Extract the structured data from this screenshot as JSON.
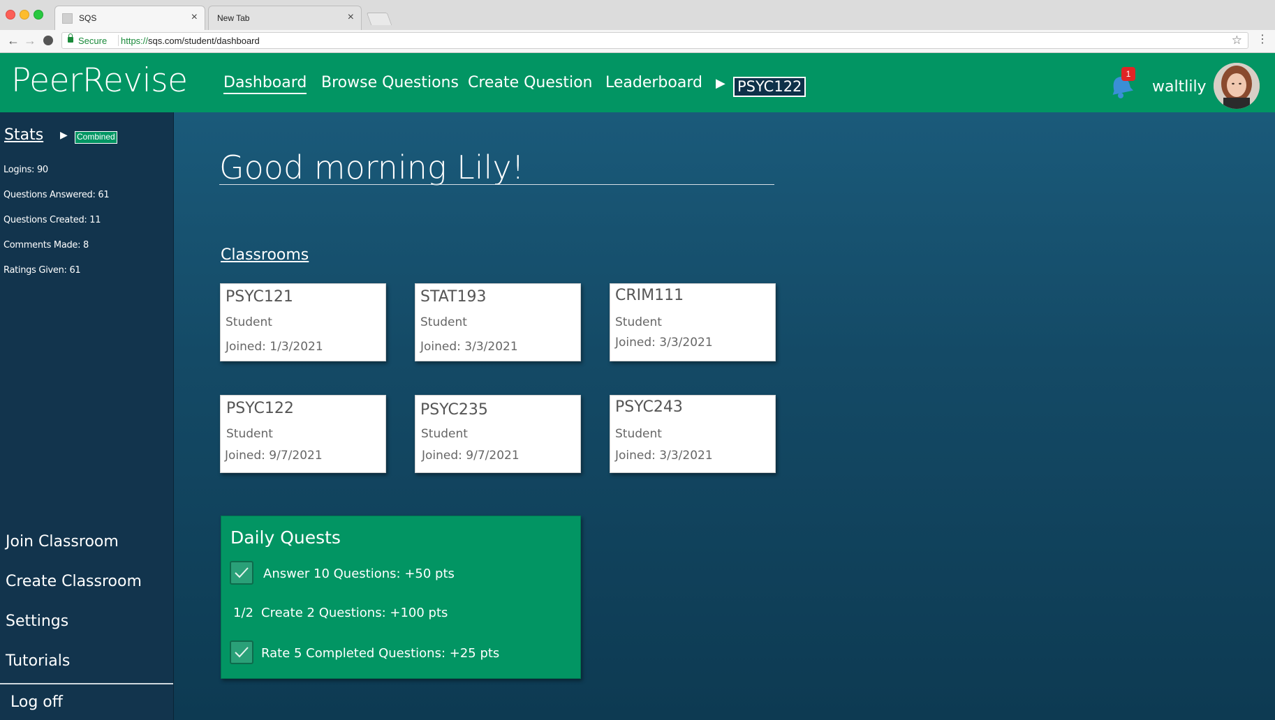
{
  "browser": {
    "tabs": [
      {
        "title": "SQS",
        "active": true
      },
      {
        "title": "New Tab",
        "active": false
      }
    ],
    "security_label": "Secure",
    "url_scheme": "https://",
    "url_rest": "sqs.com/student/dashboard"
  },
  "header": {
    "logo": "PeerRevise",
    "nav": [
      {
        "label": "Dashboard",
        "active": true
      },
      {
        "label": "Browse Questions"
      },
      {
        "label": "Create Question"
      },
      {
        "label": "Leaderboard"
      }
    ],
    "current_course": "PSYC122",
    "notification_count": "1",
    "username": "waltlily",
    "brand_color": "#029563"
  },
  "sidebar": {
    "stats_title": "Stats",
    "stats_filter": "Combined",
    "stats": [
      "Logins: 90",
      "Questions Answered: 61",
      "Questions Created: 11",
      "Comments Made: 8",
      "Ratings Given: 61"
    ],
    "links": [
      "Join Classroom",
      "Create Classroom",
      "Settings",
      "Tutorials",
      "Log off"
    ]
  },
  "main": {
    "greeting": "Good morning Lily!",
    "classrooms_title": "Classrooms",
    "classrooms": [
      {
        "code": "PSYC121",
        "role": "Student",
        "joined": "Joined: 1/3/2021"
      },
      {
        "code": "STAT193",
        "role": "Student",
        "joined": "Joined: 3/3/2021"
      },
      {
        "code": "CRIM111",
        "role": "Student",
        "joined": "Joined: 3/3/2021"
      },
      {
        "code": "PSYC122",
        "role": "Student",
        "joined": "Joined: 9/7/2021"
      },
      {
        "code": "PSYC235",
        "role": "Student",
        "joined": "Joined: 9/7/2021"
      },
      {
        "code": "PSYC243",
        "role": "Student",
        "joined": "Joined: 3/3/2021"
      }
    ],
    "quests": {
      "title": "Daily Quests",
      "items": [
        {
          "text": "Answer 10 Questions: +50 pts",
          "completed": true
        },
        {
          "progress": "1/2",
          "text": "Create 2 Questions: +100 pts",
          "completed": false
        },
        {
          "text": "Rate 5 Completed Questions: +25 pts",
          "completed": true
        }
      ]
    }
  }
}
